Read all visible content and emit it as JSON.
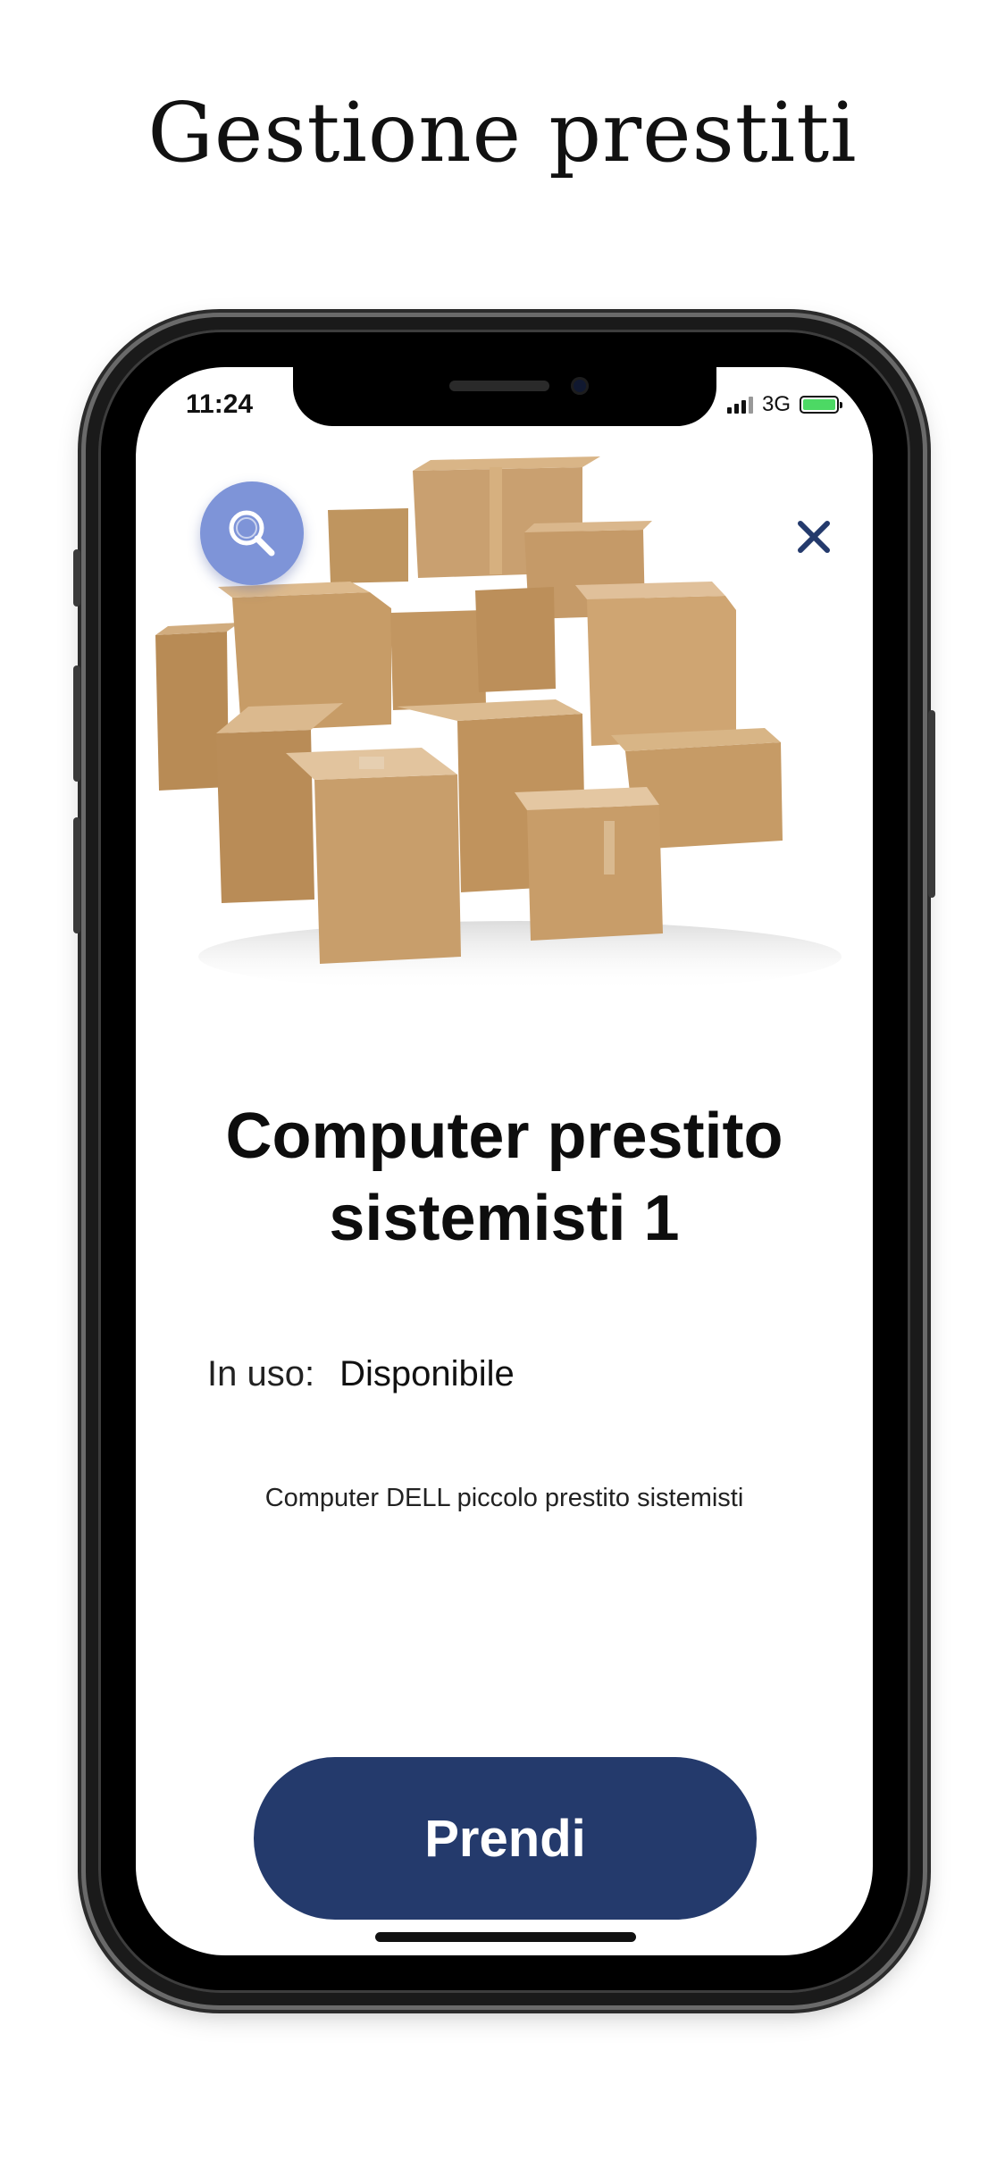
{
  "promo": {
    "title": "Gestione prestiti"
  },
  "status_bar": {
    "time": "11:24",
    "network": "3G",
    "battery_charging": true
  },
  "header": {
    "search_icon": "search-icon",
    "close_icon": "close-icon"
  },
  "item": {
    "title_line1": "Computer prestito",
    "title_line2": "sistemisti 1",
    "usage_label": "In uso:",
    "usage_value": "Disponibile",
    "description": "Computer DELL piccolo prestito sistemisti",
    "image": "cardboard-boxes"
  },
  "actions": {
    "take_label": "Prendi"
  },
  "colors": {
    "primary": "#243a6c",
    "search_button": "#7e94d8",
    "close_icon": "#243a6c",
    "battery": "#4cd964"
  }
}
